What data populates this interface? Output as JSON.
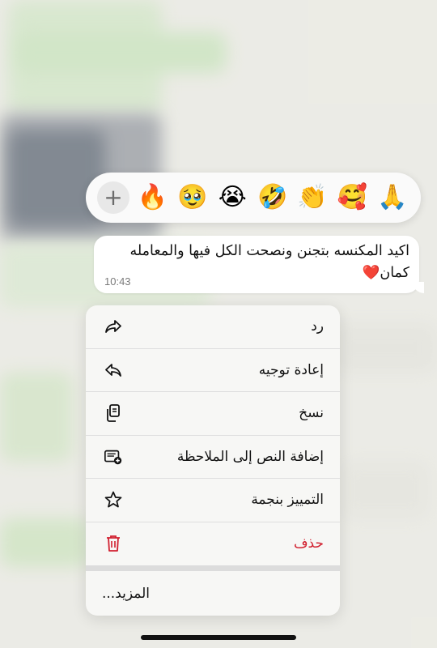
{
  "reactions": {
    "emojis": [
      "🙏",
      "🥰",
      "👏",
      "🤣",
      "😭",
      "🥹",
      "🔥"
    ],
    "more_label": "+"
  },
  "message": {
    "text": "اكيد المكنسه بتجنن ونصحت الكل فيها والمعامله كمان",
    "heart": "❤️",
    "time": "10:43"
  },
  "menu": {
    "items": [
      {
        "label": "رد",
        "icon": "reply-icon"
      },
      {
        "label": "إعادة توجيه",
        "icon": "forward-icon"
      },
      {
        "label": "نسخ",
        "icon": "copy-icon"
      },
      {
        "label": "إضافة النص إلى الملاحظة",
        "icon": "add-note-icon"
      },
      {
        "label": "التمييز بنجمة",
        "icon": "star-icon"
      },
      {
        "label": "حذف",
        "icon": "trash-icon"
      }
    ],
    "more_label": "المزيد...",
    "delete_color": "#d1202f"
  }
}
